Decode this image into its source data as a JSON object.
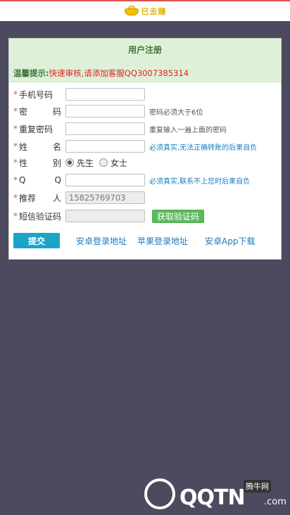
{
  "brand": {
    "logo_text": "已去赚"
  },
  "form": {
    "title": "用户注册",
    "notice_label": "温馨提示:",
    "notice_text": "快速审核,请添加客服QQ3007385314",
    "fields": {
      "phone": {
        "label_a": "手机号码",
        "value": ""
      },
      "password": {
        "label_a": "密",
        "label_b": "码",
        "value": "",
        "hint": "密码必须大于6位"
      },
      "repeat": {
        "label_a": "重复密码",
        "value": "",
        "hint": "重复输入一遍上面的密码"
      },
      "name": {
        "label_a": "姓",
        "label_b": "名",
        "value": "",
        "hint": "必须真实,无法正确转账的后果自负"
      },
      "gender": {
        "label_a": "性",
        "label_b": "别",
        "option_male": "先生",
        "option_female": "女士",
        "selected": "先生"
      },
      "qq": {
        "label_a": "Q",
        "label_b": "Q",
        "value": "",
        "hint": "必须真实,联系不上您时后果自负"
      },
      "referrer": {
        "label_a": "推荐",
        "label_b": "人",
        "value": "15825769703"
      },
      "sms": {
        "label_a": "短信验证码",
        "value": "",
        "button": "获取验证码"
      }
    },
    "submit": "提交",
    "links": {
      "android_login": "安卓登录地址",
      "apple_login": "苹果登录地址",
      "android_app": "安卓App下载"
    }
  },
  "watermark": {
    "text": "QQTN",
    "suffix": ".com",
    "badge": "腾牛网"
  },
  "colors": {
    "header_bg": "#dff0d8",
    "title_green": "#3c763d",
    "notice_red": "#e02020",
    "submit_blue": "#1aa5c8",
    "sms_green": "#5cb85c",
    "page_bg": "#4b4a5e"
  }
}
